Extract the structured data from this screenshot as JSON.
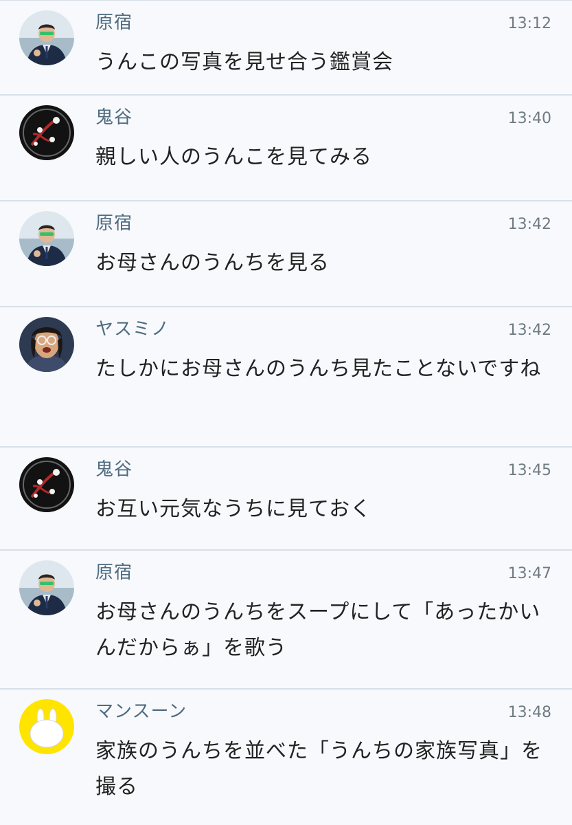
{
  "messages": [
    {
      "name": "原宿",
      "time": "13:12",
      "text": "うんこの写真を見せ合う鑑賞会",
      "avatar": "man-suit-avatar"
    },
    {
      "name": "鬼谷",
      "time": "13:40",
      "text": "親しい人のうんこを見てみる",
      "avatar": "plum-blossom-avatar"
    },
    {
      "name": "原宿",
      "time": "13:42",
      "text": "お母さんのうんちを見る",
      "avatar": "man-suit-avatar"
    },
    {
      "name": "ヤスミノ",
      "time": "13:42",
      "text": "たしかにお母さんのうんち見たことないですね",
      "avatar": "glasses-face-avatar"
    },
    {
      "name": "鬼谷",
      "time": "13:45",
      "text": "お互い元気なうちに見ておく",
      "avatar": "plum-blossom-avatar"
    },
    {
      "name": "原宿",
      "time": "13:47",
      "text": "お母さんのうんちをスープにして「あったかいんだからぁ」を歌う",
      "avatar": "man-suit-avatar"
    },
    {
      "name": "マンスーン",
      "time": "13:48",
      "text": "家族のうんちを並べた「うんちの家族写真」を撮る",
      "avatar": "rabbit-avatar"
    }
  ],
  "colors": {
    "background": "#f7f9fc",
    "name": "#4f6b7f",
    "time": "#707a83",
    "text": "#222222",
    "divider": "#d7e0e8"
  }
}
